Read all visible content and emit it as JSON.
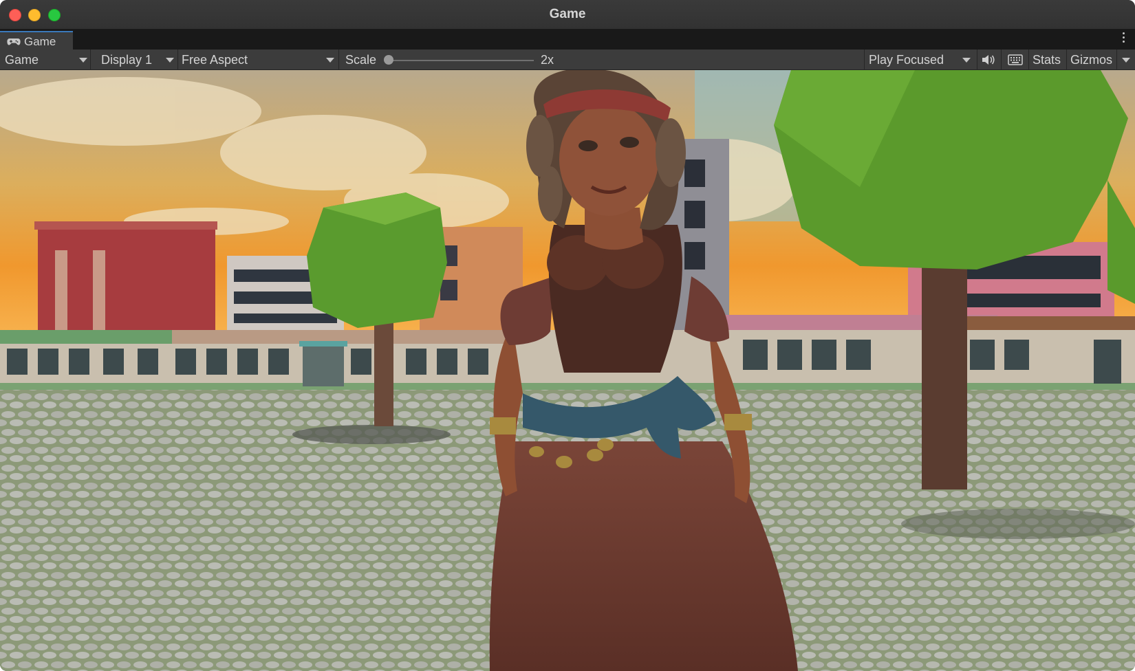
{
  "window": {
    "title": "Game"
  },
  "tab": {
    "label": "Game",
    "icon": "gamepad-icon"
  },
  "toolbar": {
    "view_dropdown": "Game",
    "display_dropdown": "Display 1",
    "aspect_dropdown": "Free Aspect",
    "scale_label": "Scale",
    "scale_value": "2x",
    "scale_slider_fraction": 0.0,
    "play_mode_dropdown": "Play Focused",
    "mute_icon": "speaker-icon",
    "keyboard_icon": "keyboard-icon",
    "stats_label": "Stats",
    "gizmos_label": "Gizmos"
  },
  "scene": {
    "description_icons": [
      "character",
      "low-poly-tree",
      "buildings",
      "cobblestone-ground",
      "sunset-sky"
    ]
  }
}
